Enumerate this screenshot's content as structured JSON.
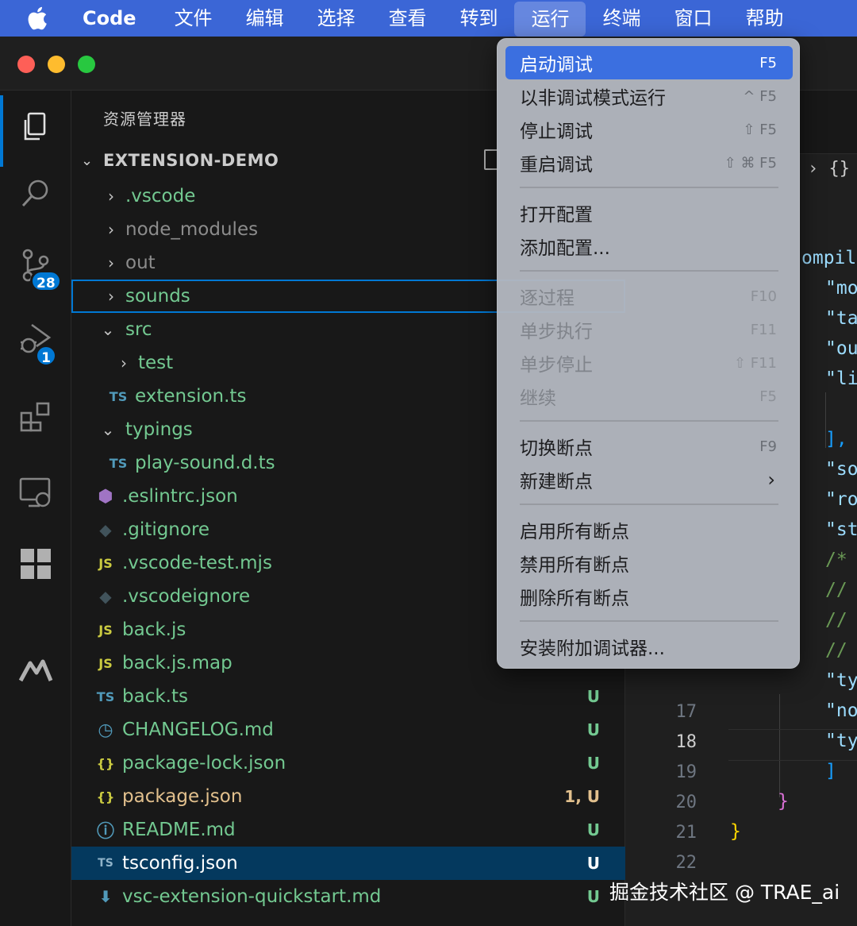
{
  "menubar": {
    "app": "Code",
    "items": [
      "文件",
      "编辑",
      "选择",
      "查看",
      "转到",
      "运行",
      "终端",
      "窗口",
      "帮助"
    ],
    "active": "运行"
  },
  "activity": {
    "scm_badge": "28",
    "debug_badge": "1"
  },
  "sidebar": {
    "title": "资源管理器",
    "section": "EXTENSION-DEMO",
    "tree": [
      {
        "label": ".vscode",
        "chev": "›",
        "icon": "",
        "status": ""
      },
      {
        "label": "node_modules",
        "chev": "›",
        "icon": "",
        "status": ""
      },
      {
        "label": "out",
        "chev": "›",
        "icon": "",
        "status": ""
      },
      {
        "label": "sounds",
        "chev": "›",
        "icon": "",
        "status": ""
      },
      {
        "label": "src",
        "chev": "⌄",
        "icon": "",
        "status": ""
      },
      {
        "label": "test",
        "chev": "›",
        "icon": "",
        "status": ""
      },
      {
        "label": "extension.ts",
        "chev": "",
        "icon": "TS",
        "status": ""
      },
      {
        "label": "typings",
        "chev": "⌄",
        "icon": "",
        "status": ""
      },
      {
        "label": "play-sound.d.ts",
        "chev": "",
        "icon": "TS",
        "status": ""
      },
      {
        "label": ".eslintrc.json",
        "chev": "",
        "icon": "⬢",
        "status": ""
      },
      {
        "label": ".gitignore",
        "chev": "",
        "icon": "◆",
        "status": ""
      },
      {
        "label": ".vscode-test.mjs",
        "chev": "",
        "icon": "JS",
        "status": ""
      },
      {
        "label": ".vscodeignore",
        "chev": "",
        "icon": "◆",
        "status": ""
      },
      {
        "label": "back.js",
        "chev": "",
        "icon": "JS",
        "status": ""
      },
      {
        "label": "back.js.map",
        "chev": "",
        "icon": "JS",
        "status": ""
      },
      {
        "label": "back.ts",
        "chev": "",
        "icon": "TS",
        "status": "U"
      },
      {
        "label": "CHANGELOG.md",
        "chev": "",
        "icon": "◷",
        "status": "U"
      },
      {
        "label": "package-lock.json",
        "chev": "",
        "icon": "{}",
        "status": "U"
      },
      {
        "label": "package.json",
        "chev": "",
        "icon": "{}",
        "status": "1, U"
      },
      {
        "label": "README.md",
        "chev": "",
        "icon": "ⓘ",
        "status": "U"
      },
      {
        "label": "tsconfig.json",
        "chev": "",
        "icon": "TS",
        "status": "U"
      },
      {
        "label": "vsc-extension-quickstart.md",
        "chev": "",
        "icon": "⬇",
        "status": "U"
      }
    ]
  },
  "editor": {
    "breadcrumb": "› {}",
    "line_numbers": [
      "17",
      "18",
      "19",
      "20",
      "21",
      "22"
    ],
    "current_line": "18",
    "code_fragments": [
      "ompil",
      "\"mo",
      "\"ta",
      "\"ou",
      "\"li",
      "],",
      "\"so",
      "\"ro",
      "\"st",
      "/*",
      "//",
      "//",
      "//",
      "\"ty",
      "\"no",
      "\"ty",
      "]",
      "}",
      "}"
    ]
  },
  "run_menu": {
    "items": [
      {
        "label": "启动调试",
        "key": "F5"
      },
      {
        "label": "以非调试模式运行",
        "key": "^ F5"
      },
      {
        "label": "停止调试",
        "key": "⇧ F5"
      },
      {
        "label": "重启调试",
        "key": "⇧ ⌘ F5"
      },
      {
        "label": "打开配置",
        "key": ""
      },
      {
        "label": "添加配置...",
        "key": ""
      },
      {
        "label": "逐过程",
        "key": "F10"
      },
      {
        "label": "单步执行",
        "key": "F11"
      },
      {
        "label": "单步停止",
        "key": "⇧ F11"
      },
      {
        "label": "继续",
        "key": "F5"
      },
      {
        "label": "切换断点",
        "key": "F9"
      },
      {
        "label": "新建断点",
        "key": "›"
      },
      {
        "label": "启用所有断点",
        "key": ""
      },
      {
        "label": "禁用所有断点",
        "key": ""
      },
      {
        "label": "删除所有断点",
        "key": ""
      },
      {
        "label": "安装附加调试器...",
        "key": ""
      }
    ]
  },
  "watermark": "掘金技术社区 @ TRAE_ai"
}
